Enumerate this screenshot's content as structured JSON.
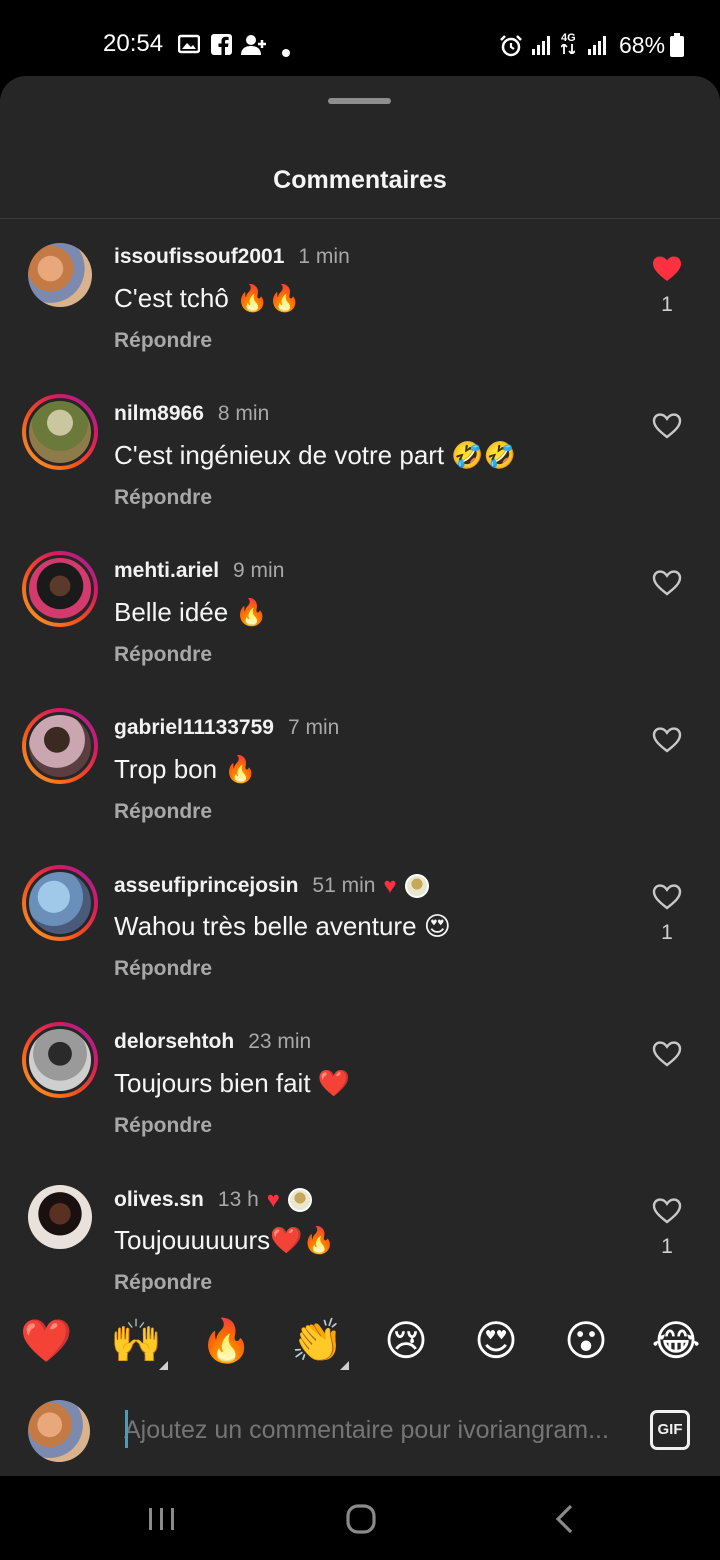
{
  "status_bar": {
    "time": "20:54",
    "battery": "68%",
    "network": "4G"
  },
  "sheet": {
    "title": "Commentaires"
  },
  "comments": [
    {
      "username": "issoufissouf2001",
      "time": "1 min",
      "text": "C'est tchô 🔥🔥",
      "reply": "Répondre",
      "liked": true,
      "like_count": "1",
      "ring": false,
      "creator_liked": false
    },
    {
      "username": "nilm8966",
      "time": "8 min",
      "text": "C'est ingénieux de votre part 🤣🤣",
      "reply": "Répondre",
      "liked": false,
      "like_count": "",
      "ring": true,
      "creator_liked": false
    },
    {
      "username": "mehti.ariel",
      "time": "9 min",
      "text": "Belle idée 🔥",
      "reply": "Répondre",
      "liked": false,
      "like_count": "",
      "ring": true,
      "creator_liked": false
    },
    {
      "username": "gabriel11133759",
      "time": "7 min",
      "text": "Trop bon 🔥",
      "reply": "Répondre",
      "liked": false,
      "like_count": "",
      "ring": true,
      "creator_liked": false
    },
    {
      "username": "asseufiprincejosin",
      "time": "51 min",
      "text": "Wahou très belle aventure 😍",
      "reply": "Répondre",
      "liked": false,
      "like_count": "1",
      "ring": true,
      "creator_liked": true
    },
    {
      "username": "delorsehtoh",
      "time": "23 min",
      "text": "Toujours bien fait ❤️",
      "reply": "Répondre",
      "liked": false,
      "like_count": "",
      "ring": true,
      "creator_liked": false
    },
    {
      "username": "olives.sn",
      "time": "13 h",
      "text": "Toujouuuuurs❤️🔥",
      "reply": "Répondre",
      "liked": false,
      "like_count": "1",
      "ring": false,
      "creator_liked": true
    }
  ],
  "emoji_bar": [
    "❤️",
    "🙌",
    "🔥",
    "👏",
    "😢",
    "😍",
    "😮",
    "😂"
  ],
  "composer": {
    "placeholder": "Ajoutez un commentaire pour ivoriangram...",
    "gif_label": "GIF"
  },
  "colors": {
    "sheet_bg": "#262626",
    "like_red": "#ff3040",
    "caret": "#3ba1c8"
  }
}
